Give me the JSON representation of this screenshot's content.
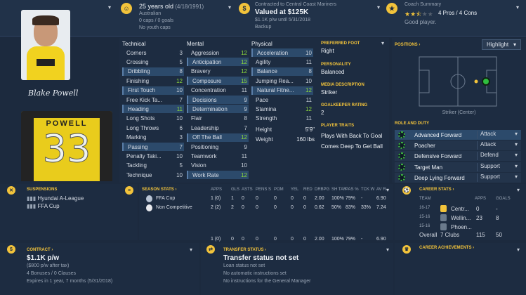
{
  "header": {
    "age": "25 years old",
    "dob": "(4/18/1991)",
    "nationality": "Australian",
    "caps": "0 caps / 0 goals",
    "youth_caps": "No youth caps",
    "contract_line": "Contracted to Central Coast Mariners",
    "value": "Valued at $125K",
    "wage_line": "$1.1K p/w until 5/31/2018",
    "squad_status": "Backup",
    "coach_summary_label": "Coach Summary",
    "pros_cons": "4 Pros / 4 Cons",
    "coach_verdict": "Good player.",
    "stars": 2.5
  },
  "player": {
    "signature": "Blake Powell",
    "shirt_name": "POWELL",
    "shirt_number": "33"
  },
  "attributes": {
    "technical_title": "Technical",
    "mental_title": "Mental",
    "physical_title": "Physical",
    "technical": [
      {
        "name": "Corners",
        "value": "3"
      },
      {
        "name": "Crossing",
        "value": "5"
      },
      {
        "name": "Dribbling",
        "value": "8"
      },
      {
        "name": "Finishing",
        "value": "12"
      },
      {
        "name": "First Touch",
        "value": "10"
      },
      {
        "name": "Free Kick Ta...",
        "value": "7"
      },
      {
        "name": "Heading",
        "value": "11"
      },
      {
        "name": "Long Shots",
        "value": "10"
      },
      {
        "name": "Long Throws",
        "value": "6"
      },
      {
        "name": "Marking",
        "value": "3"
      },
      {
        "name": "Passing",
        "value": "7"
      },
      {
        "name": "Penalty Taki...",
        "value": "10"
      },
      {
        "name": "Tackling",
        "value": "5"
      },
      {
        "name": "Technique",
        "value": "10"
      }
    ],
    "mental": [
      {
        "name": "Aggression",
        "value": "12"
      },
      {
        "name": "Anticipation",
        "value": "12"
      },
      {
        "name": "Bravery",
        "value": "12"
      },
      {
        "name": "Composure",
        "value": "15"
      },
      {
        "name": "Concentration",
        "value": "11"
      },
      {
        "name": "Decisions",
        "value": "9"
      },
      {
        "name": "Determination",
        "value": "9"
      },
      {
        "name": "Flair",
        "value": "8"
      },
      {
        "name": "Leadership",
        "value": "7"
      },
      {
        "name": "Off The Ball",
        "value": "12"
      },
      {
        "name": "Positioning",
        "value": "9"
      },
      {
        "name": "Teamwork",
        "value": "11"
      },
      {
        "name": "Vision",
        "value": "10"
      },
      {
        "name": "Work Rate",
        "value": "12"
      }
    ],
    "physical": [
      {
        "name": "Acceleration",
        "value": "10"
      },
      {
        "name": "Agility",
        "value": "11"
      },
      {
        "name": "Balance",
        "value": "8"
      },
      {
        "name": "Jumping Rea...",
        "value": "10"
      },
      {
        "name": "Natural Fitne...",
        "value": "12"
      },
      {
        "name": "Pace",
        "value": "11"
      },
      {
        "name": "Stamina",
        "value": "12"
      },
      {
        "name": "Strength",
        "value": "11"
      }
    ],
    "height_label": "Height",
    "height": "5'9\"",
    "weight_label": "Weight",
    "weight": "160 lbs"
  },
  "info": {
    "preferred_foot_label": "PREFERRED FOOT",
    "preferred_foot": "Right",
    "personality_label": "PERSONALITY",
    "personality": "Balanced",
    "media_label": "MEDIA DESCRIPTION",
    "media": "Striker",
    "gk_label": "GOALKEEPER RATING",
    "gk": "2",
    "traits_label": "PLAYER TRAITS",
    "traits": [
      "Plays With Back To Goal",
      "Comes Deep To Get Ball"
    ]
  },
  "positions": {
    "title": "POSITIONS",
    "select": "Highlight",
    "caption": "Striker (Center)"
  },
  "roles": {
    "title": "ROLE AND DUTY",
    "items": [
      {
        "role": "Advanced Forward",
        "duty": "Attack"
      },
      {
        "role": "Poacher",
        "duty": "Attack"
      },
      {
        "role": "Defensive Forward",
        "duty": "Defend"
      },
      {
        "role": "Target Man",
        "duty": "Support"
      },
      {
        "role": "Deep Lying Forward",
        "duty": "Support"
      }
    ]
  },
  "suspensions": {
    "title": "SUSPENSIONS",
    "items": [
      "Hyundai A-League",
      "FFA Cup"
    ]
  },
  "season": {
    "title": "SEASON STATS",
    "headers": [
      "APPS",
      "GLS",
      "ASTS",
      "PENS S",
      "POM",
      "YEL",
      "RED",
      "DRBPG",
      "SH TAR",
      "PAS %",
      "TCK W",
      "AV R..."
    ],
    "rows": [
      {
        "name": "FFA Cup",
        "cells": [
          "1 (0)",
          "1",
          "0",
          "0",
          "0",
          "0",
          "0",
          "2.00",
          "100%",
          "79%",
          "-",
          "6.90"
        ]
      },
      {
        "name": "Non Competitive",
        "cells": [
          "2 (2)",
          "2",
          "0",
          "0",
          "0",
          "0",
          "0",
          "0.62",
          "50%",
          "83%",
          "33%",
          "7.24"
        ]
      }
    ],
    "total_cells": [
      "1 (0)",
      "0",
      "0",
      "0",
      "0",
      "0",
      "0",
      "2.00",
      "100%",
      "79%",
      "-",
      "6.90"
    ]
  },
  "career": {
    "title": "CAREER STATS",
    "headers": [
      "TEAM",
      "APPS",
      "GOALS"
    ],
    "rows": [
      {
        "season": "16-17",
        "team": "Centr...",
        "apps": "0",
        "goals": "-"
      },
      {
        "season": "15-16",
        "team": "Wellin...",
        "apps": "23",
        "goals": "8"
      },
      {
        "season": "15-16",
        "team": "Phoen...",
        "apps": "",
        "goals": ""
      }
    ],
    "overall_label": "Overall",
    "overall_team": "7 Clubs",
    "overall_apps": "115",
    "overall_goals": "50"
  },
  "contract": {
    "title": "CONTRACT",
    "wage": "$1.1K p/w",
    "after_tax": "($800 p/w after tax)",
    "bonuses": "4 Bonuses / 0 Clauses",
    "expires": "Expires in 1 year, 7 months  (5/31/2018)"
  },
  "transfer": {
    "title": "TRANSFER STATUS",
    "headline": "Transfer status not set",
    "lines": [
      "Loan status not set",
      "No automatic instructions set",
      "No instructions for the General Manager"
    ]
  },
  "achievements": {
    "title": "CAREER ACHIEVEMENTS"
  }
}
